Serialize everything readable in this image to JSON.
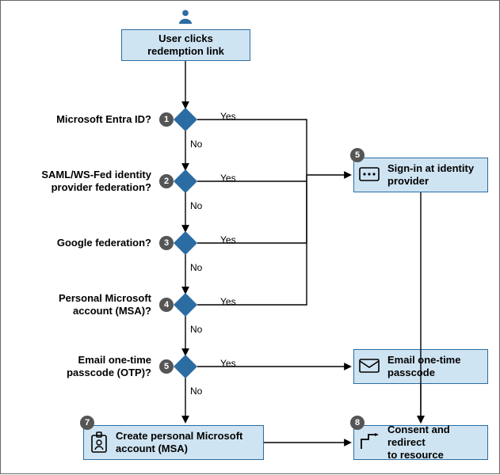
{
  "colors": {
    "box_fill": "#cfe4f2",
    "box_border": "#2b6ca3",
    "diamond_fill": "#2b6ca3",
    "step_fill": "#555555",
    "arrow": "#000000"
  },
  "start": {
    "label": "User clicks\nredemption link",
    "icon": "user-icon"
  },
  "decisions": [
    {
      "num": "1",
      "question": "Microsoft Entra ID?",
      "yes": "Yes",
      "no": "No"
    },
    {
      "num": "2",
      "question": "SAML/WS-Fed identity\nprovider federation?",
      "yes": "Yes",
      "no": "No"
    },
    {
      "num": "3",
      "question": "Google federation?",
      "yes": "Yes",
      "no": "No"
    },
    {
      "num": "4",
      "question": "Personal Microsoft\naccount (MSA)?",
      "yes": "Yes",
      "no": "No"
    },
    {
      "num": "5",
      "question": "Email one-time\npasscode (OTP)?",
      "yes": "Yes",
      "no": "No"
    }
  ],
  "actions": {
    "signin": {
      "num": "5",
      "label": "Sign-in at identity\nprovider",
      "icon": "password-icon"
    },
    "otp": {
      "label": "Email one-time\npasscode",
      "icon": "envelope-icon"
    },
    "create": {
      "num": "7",
      "label": "Create personal Microsoft\naccount (MSA)",
      "icon": "badge-icon"
    },
    "consent": {
      "num": "8",
      "label": "Consent and redirect\nto resource",
      "icon": "redirect-icon"
    }
  }
}
